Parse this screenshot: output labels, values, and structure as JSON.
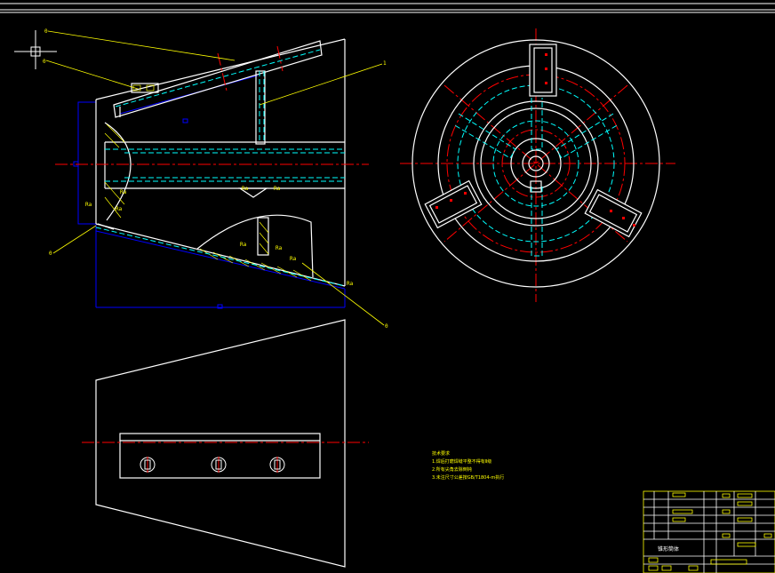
{
  "drawing": {
    "title": "",
    "colors": {
      "background": "#000000",
      "outline": "#ffffff",
      "centerline": "#ff0000",
      "dimension": "#0000ff",
      "hidden": "#00ffff",
      "annotation": "#ffff00"
    },
    "callouts": [
      "0",
      "0",
      "1",
      "0",
      "0"
    ],
    "tech_notes": {
      "heading": "技术要求",
      "lines": [
        "1.焊后打磨焊缝平整不得有Ⅱ级",
        "2.所有尖角去除倒钝",
        "3.未注尺寸公差按GB/T1804-m执行"
      ]
    },
    "title_block": {
      "drawing_name": "锥形筒体"
    }
  }
}
